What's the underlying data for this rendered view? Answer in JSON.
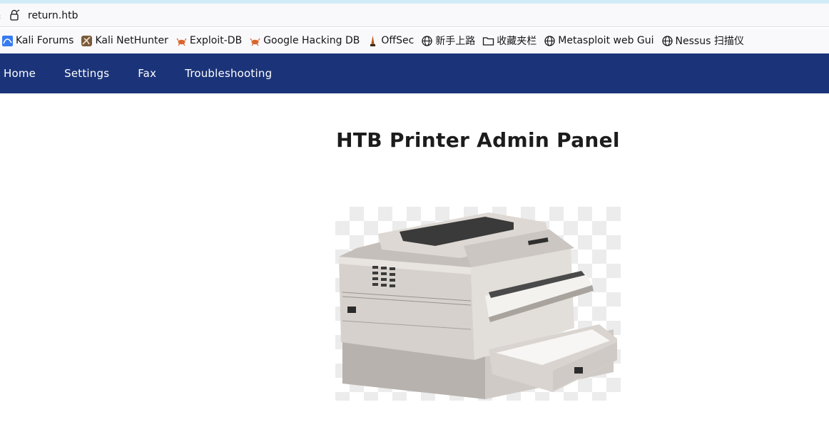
{
  "browser": {
    "url": "return.htb",
    "bookmarks": [
      {
        "label": "Kali Forums",
        "icon": "kali-icon"
      },
      {
        "label": "Kali NetHunter",
        "icon": "nethunter-icon"
      },
      {
        "label": "Exploit-DB",
        "icon": "exploitdb-icon"
      },
      {
        "label": "Google Hacking DB",
        "icon": "ghdb-icon"
      },
      {
        "label": "OffSec",
        "icon": "offsec-icon"
      },
      {
        "label": "新手上路",
        "icon": "globe-icon"
      },
      {
        "label": "收藏夹栏",
        "icon": "folder-icon"
      },
      {
        "label": "Metasploit web Gui",
        "icon": "globe-icon"
      },
      {
        "label": "Nessus 扫描仪",
        "icon": "globe-icon"
      }
    ]
  },
  "nav": {
    "items": [
      {
        "label": "Home"
      },
      {
        "label": "Settings"
      },
      {
        "label": "Fax"
      },
      {
        "label": "Troubleshooting"
      }
    ]
  },
  "main": {
    "title": "HTB Printer Admin Panel",
    "image_icon": "printer-image"
  },
  "colors": {
    "nav_bg": "#1b3479",
    "nav_text": "#ffffff",
    "title_text": "#1c1c1c"
  }
}
